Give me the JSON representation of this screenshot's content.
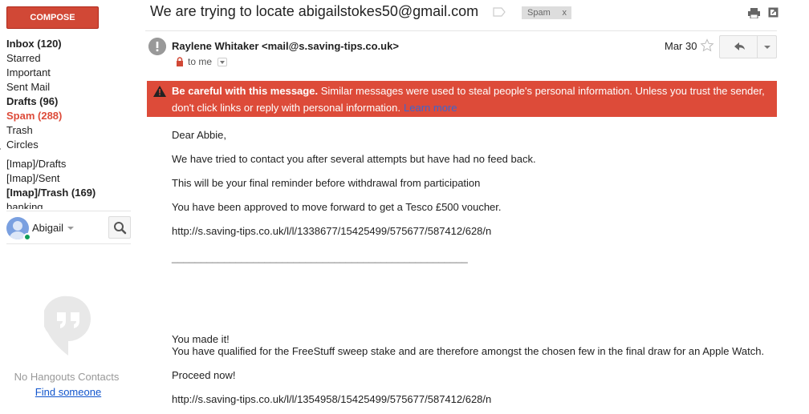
{
  "nav": {
    "compose": "COMPOSE",
    "items": [
      {
        "label": "Inbox (120)"
      },
      {
        "label": "Starred"
      },
      {
        "label": "Important"
      },
      {
        "label": "Sent Mail"
      },
      {
        "label": "Drafts (96)"
      },
      {
        "label": "Spam (288)"
      },
      {
        "label": "Trash"
      },
      {
        "label": "Circles"
      },
      {
        "label": "[Imap]/Drafts"
      },
      {
        "label": "[Imap]/Sent"
      },
      {
        "label": "[Imap]/Trash (169)"
      },
      {
        "label": "banking"
      }
    ]
  },
  "hangouts": {
    "user": "Abigail",
    "empty": "No Hangouts Contacts",
    "find": "Find someone"
  },
  "header": {
    "subject": "We are trying to locate abigailstokes50@gmail.com",
    "label": "Spam",
    "label_close": "x"
  },
  "message": {
    "sender": "Raylene Whitaker",
    "email": "<mail@s.saving-tips.co.uk>",
    "to": "to me",
    "date": "Mar 30"
  },
  "warning": {
    "bold": "Be careful with this message.",
    "text": " Similar messages were used to steal people's personal information. Unless you trust the sender, don't click links or reply with personal information.",
    "link": "Learn more"
  },
  "body": {
    "greeting": "Dear Abbie,",
    "p1": "We have tried to contact you after several attempts but have had no feed back.",
    "p2": "This will be your final reminder before withdrawal from participation",
    "p3": "You have been approved to move forward to get a Tesco £500 voucher.",
    "link1": "http://s.saving-tips.co.uk/l/l/1338677/15425499/575677/587412/628/n",
    "divider": "___________________________________________________",
    "p4": "You made it!",
    "p5": "You have qualified for the FreeStuff sweep stake and are therefore amongst the chosen few in the final draw for an Apple Watch.",
    "p6": "Proceed now!",
    "link2": "http://s.saving-tips.co.uk/l/l/1354958/15425499/575677/587412/628/n"
  },
  "colors": {
    "compose": "#d14836",
    "warning": "#dd4b39",
    "spam_nav": "#dd4b39",
    "link": "#15c"
  }
}
